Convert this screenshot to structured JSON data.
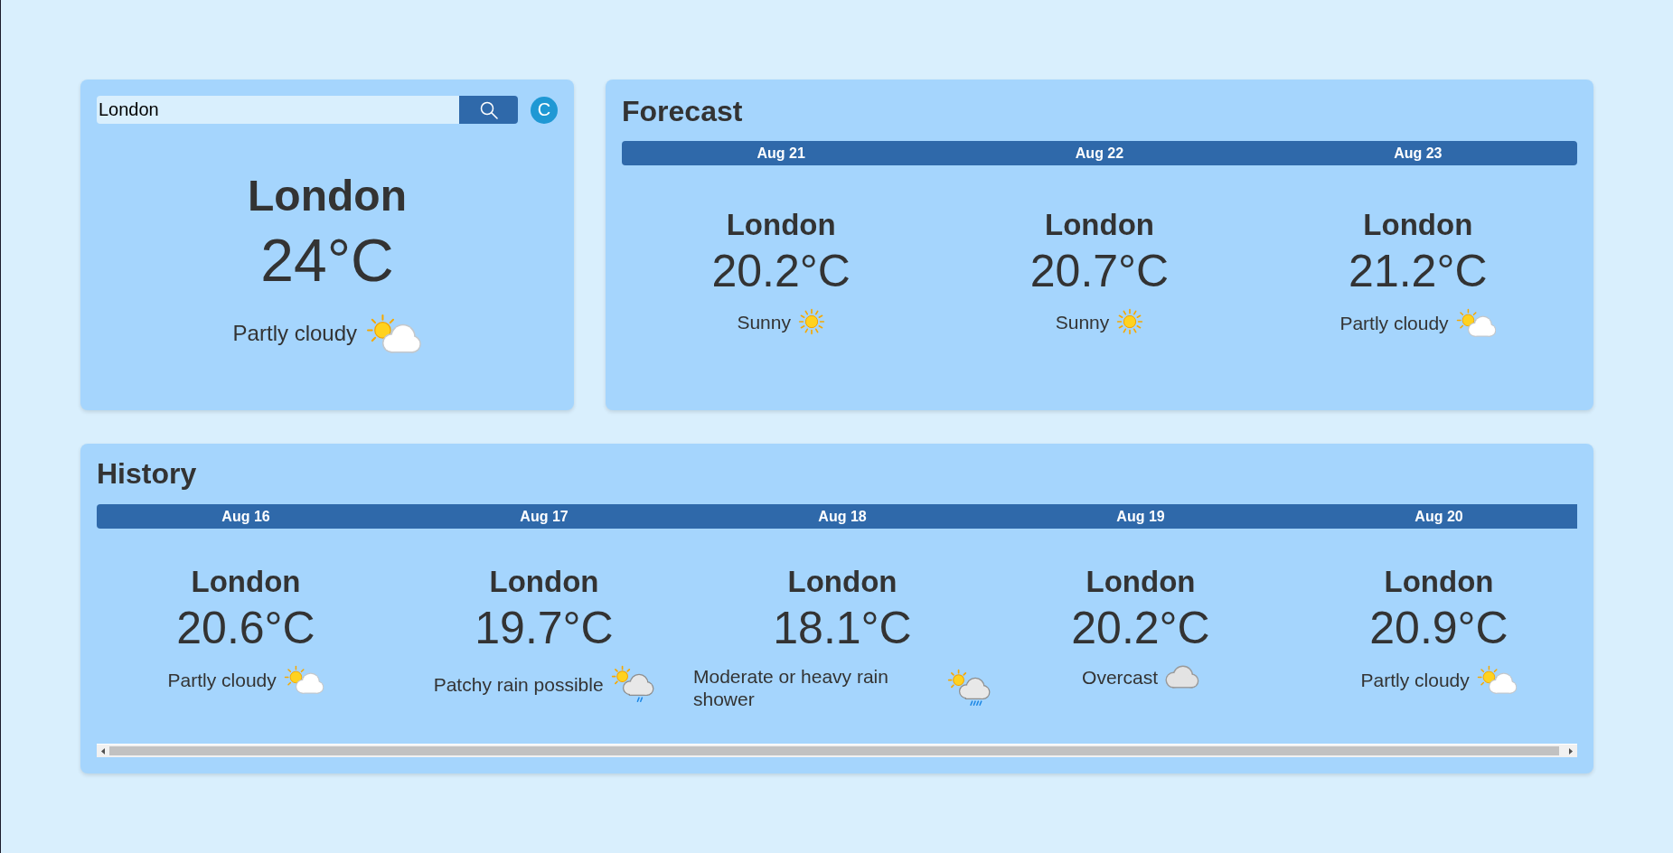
{
  "search": {
    "value": "London"
  },
  "unit_toggle": {
    "label": "C"
  },
  "current": {
    "city": "London",
    "temperature": "24°C",
    "condition": "Partly cloudy",
    "kind": "partlycloudy"
  },
  "forecast": {
    "title": "Forecast",
    "days": [
      {
        "date": "Aug 21",
        "city": "London",
        "temperature": "20.2°C",
        "condition": "Sunny",
        "kind": "sunny"
      },
      {
        "date": "Aug 22",
        "city": "London",
        "temperature": "20.7°C",
        "condition": "Sunny",
        "kind": "sunny"
      },
      {
        "date": "Aug 23",
        "city": "London",
        "temperature": "21.2°C",
        "condition": "Partly cloudy",
        "kind": "partlycloudy"
      }
    ]
  },
  "history": {
    "title": "History",
    "days": [
      {
        "date": "Aug 16",
        "city": "London",
        "temperature": "20.6°C",
        "condition": "Partly cloudy",
        "kind": "partlycloudy"
      },
      {
        "date": "Aug 17",
        "city": "London",
        "temperature": "19.7°C",
        "condition": "Patchy rain possible",
        "kind": "patchyrain"
      },
      {
        "date": "Aug 18",
        "city": "London",
        "temperature": "18.1°C",
        "condition": "Moderate or heavy rain shower",
        "kind": "heavyrain"
      },
      {
        "date": "Aug 19",
        "city": "London",
        "temperature": "20.2°C",
        "condition": "Overcast",
        "kind": "overcast"
      },
      {
        "date": "Aug 20",
        "city": "London",
        "temperature": "20.9°C",
        "condition": "Partly cloudy",
        "kind": "partlycloudy"
      }
    ]
  }
}
